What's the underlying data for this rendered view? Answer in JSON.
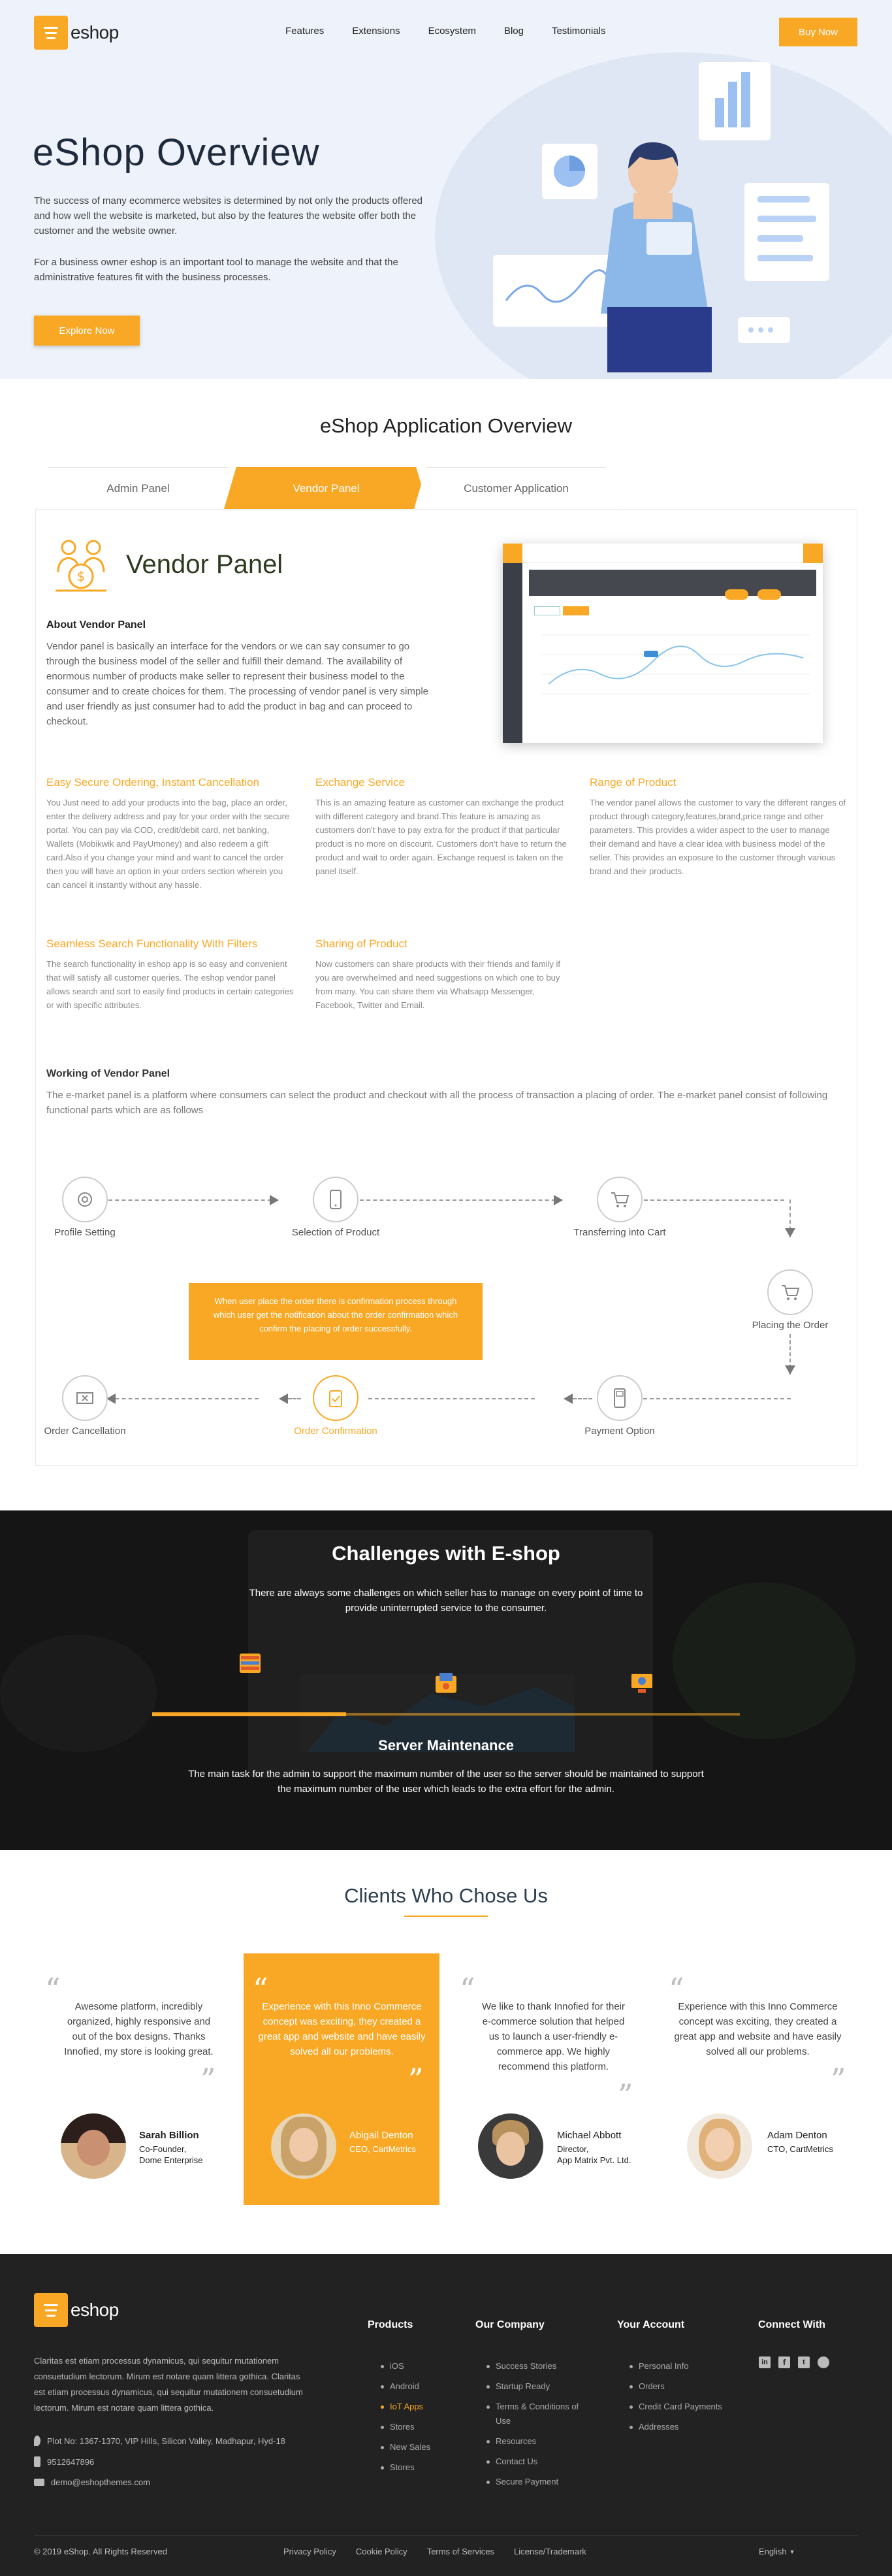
{
  "brand": {
    "name": "eshop"
  },
  "nav": {
    "items": [
      "Features",
      "Extensions",
      "Ecosystem",
      "Blog",
      "Testimonials"
    ],
    "buy_label": "Buy Now"
  },
  "hero": {
    "title": "eShop Overview",
    "p1": "The success of many ecommerce websites is determined by not only the products offered and how well the website is marketed, but also by the features the website offer both the customer and the website owner.",
    "p2": "For a business owner eshop is an important tool to manage the website and that the administrative features fit with the business processes.",
    "cta": "Explore Now"
  },
  "overview": {
    "title": "eShop Application Overview",
    "tabs": [
      "Admin Panel",
      "Vendor Panel",
      "Customer Application"
    ],
    "active_tab": 1
  },
  "vendor": {
    "heading": "Vendor Panel",
    "about_h": "About Vendor Panel",
    "about_p": "Vendor panel is basically an interface for the vendors or we can say consumer to go through the business model of the seller and fulfill their demand. The availability of enormous number of products make seller to represent their business model to the consumer and to create choices for them. The processing of vendor panel is very simple and user friendly as just consumer had to add the product in bag and can proceed to checkout.",
    "features": [
      {
        "title": "Easy Secure Ordering, Instant Cancellation",
        "text": "You Just need to add your products into the bag, place an order, enter the delivery address and pay for your order with the secure portal. You can pay via COD, credit/debit card, net banking, Wallets (Mobikwik and PayUmoney) and also redeem a gift card.Also if you change your mind and want to cancel the order then you will have an option in your orders section wherein you can cancel it instantly without any hassle."
      },
      {
        "title": "Exchange Service",
        "text": "This is an amazing feature as customer can exchange the product with different category and brand.This feature is amazing as customers don't have to pay extra for the product if that particular product is no more on discount. Customers don't have to return the product and wait to order again. Exchange request is taken on the panel itself."
      },
      {
        "title": "Range of Product",
        "text": "The vendor panel allows the customer to vary the different ranges of product through category,features,brand,price range and other parameters. This provides a wider aspect to the user to manage their demand and have a  clear idea with business model of the seller. This provides an exposure to the customer through various brand and their products."
      },
      {
        "title": "Seamless Search Functionality With Filters",
        "text": "The search functionality in eshop app is so easy and convenient that will satisfy all customer queries. The eshop vendor panel allows search and sort to easily find products in certain categories or with specific attributes."
      },
      {
        "title": "Sharing of Product",
        "text": "Now customers can share products with their friends and family if you are overwhelmed and need suggestions on which one to buy from many. You can share them via Whatsapp Messenger, Facebook, Twitter and Email."
      }
    ],
    "working_h": "Working of Vendor Panel",
    "working_p": "The e-market panel is a platform where consumers can select the product and checkout with all the process of transaction a placing of order. The e-market panel consist of following functional parts which are as follows",
    "steps": [
      "Profile Setting",
      "Selection of Product",
      "Transferring into Cart",
      "Placing the Order",
      "Payment Option",
      "Order Confirmation",
      "Order Cancellation"
    ],
    "callout": "When user place the order there is confirmation process through which user get the notification about the order confirmation which confirm the placing of order successfully."
  },
  "challenges": {
    "title": "Challenges with E-shop",
    "subtitle": "There are always some challenges on which seller has to manage on every point of time to provide uninterrupted service to the consumer.",
    "item_title": "Server Maintenance",
    "item_text": "The main task for the admin to support the maximum number of the user so the server should be maintained to support the maximum number of the user which leads to the extra effort for the admin.",
    "progress": 0.33
  },
  "clients": {
    "title": "Clients Who Chose Us",
    "items": [
      {
        "text": "Awesome platform, incredibly organized, highly responsive and out of the box designs. Thanks Innofied, my store is looking great.",
        "name": "Sarah Billion",
        "role": "Co-Founder,\nDome Enterprise"
      },
      {
        "text": "Experience with this Inno Commerce concept was exciting, they created a great app and website and have easily solved all our problems.",
        "name": "Abigail Denton",
        "role": "CEO, CartMetrics"
      },
      {
        "text": "We like to thank Innofied for their e-commerce solution that helped us to launch a user-friendly e-commerce app. We highly recommend this platform.",
        "name": "Michael Abbott",
        "role": "Director,\nApp Matrix Pvt. Ltd."
      },
      {
        "text": "Experience with this Inno Commerce concept was exciting, they created a great app and website and have easily solved all our problems.",
        "name": "Adam Denton",
        "role": "CTO, CartMetrics"
      }
    ]
  },
  "footer": {
    "about": "Claritas est etiam processus dynamicus, qui sequitur mutationem consuetudium lectorum. Mirum est notare quam littera gothica. Claritas est etiam processus dynamicus, qui sequitur mutationem consuetudium lectorum. Mirum est notare quam littera gothica.",
    "address": "Plot No: 1367-1370, VIP Hills, Silicon Valley, Madhapur, Hyd-18",
    "phone": "9512647896",
    "email": "demo@eshopthemes.com",
    "products_h": "Products",
    "products": [
      "iOS",
      "Android",
      "IoT Apps",
      "Stores",
      "New Sales",
      "Stores"
    ],
    "company_h": "Our Company",
    "company": [
      "Success Stories",
      "Startup Ready",
      "Terms & Conditions of Use",
      "Resources",
      "Contact Us",
      "Secure Payment"
    ],
    "account_h": "Your Account",
    "account": [
      "Personal Info",
      "Orders",
      "Credit Card Payments",
      "Addresses"
    ],
    "connect_h": "Connect With",
    "copyright": "© 2019 eShop. All Rights Reserved",
    "links": [
      "Privacy Policy",
      "Cookie Policy",
      "Terms of Services",
      "License/Trademark"
    ],
    "lang": "English"
  },
  "colors": {
    "accent": "#f9a825",
    "dark": "#222222",
    "hero_bg": "#eef2fa"
  }
}
